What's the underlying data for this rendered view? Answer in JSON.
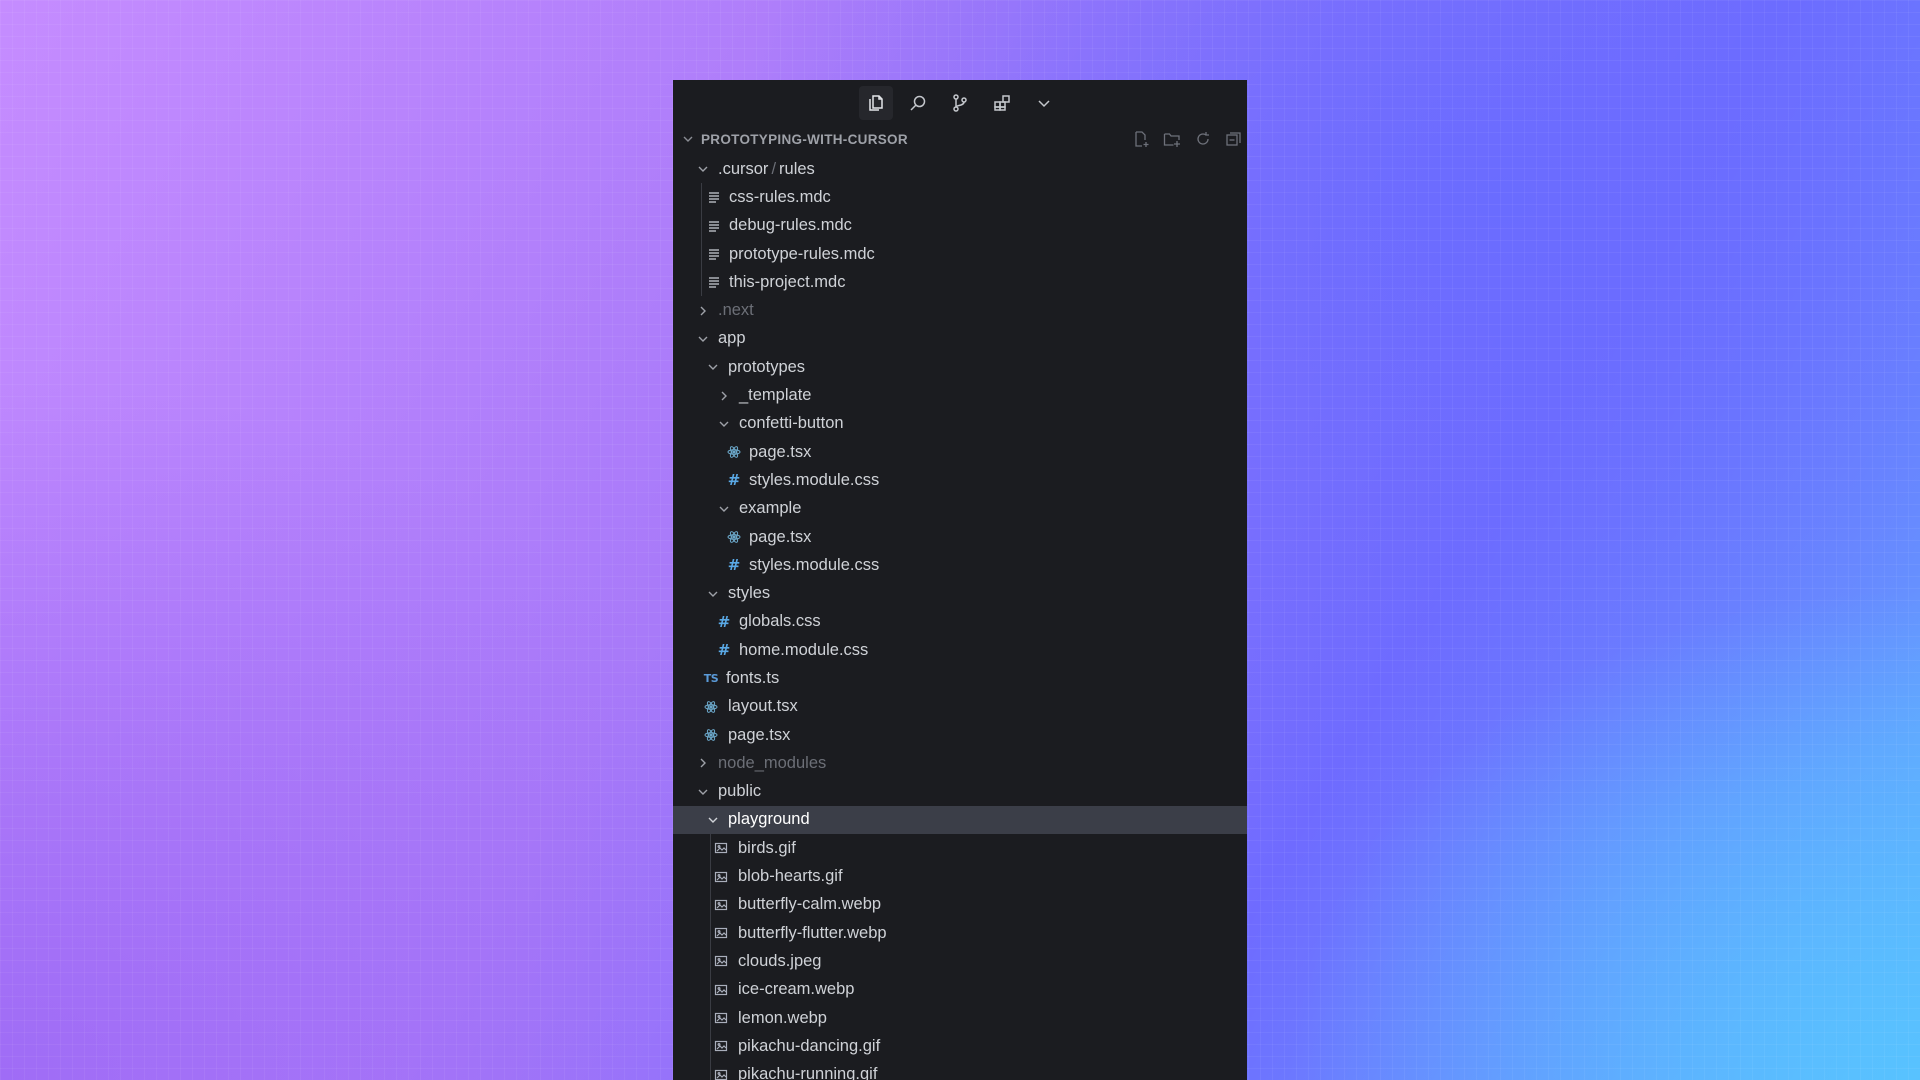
{
  "activity_bar": {
    "items": [
      {
        "icon": "files-icon",
        "active": true
      },
      {
        "icon": "search-icon",
        "active": false
      },
      {
        "icon": "source-control-icon",
        "active": false
      },
      {
        "icon": "extensions-icon",
        "active": false
      },
      {
        "icon": "chevron-down-icon",
        "active": false
      }
    ]
  },
  "explorer": {
    "title": "PROTOTYPING-WITH-CURSOR",
    "actions": [
      "new-file-icon",
      "new-folder-icon",
      "refresh-icon",
      "collapse-all-icon"
    ]
  },
  "tree": {
    "cursor_folder": {
      "part1": ".cursor",
      "sep": "/",
      "part2": "rules"
    },
    "css_rules": "css-rules.mdc",
    "debug_rules": "debug-rules.mdc",
    "prototype_rules": "prototype-rules.mdc",
    "this_project": "this-project.mdc",
    "next": ".next",
    "app": "app",
    "prototypes": "prototypes",
    "template": "_template",
    "confetti_button": "confetti-button",
    "confetti_page": "page.tsx",
    "confetti_styles": "styles.module.css",
    "example": "example",
    "example_page": "page.tsx",
    "example_styles": "styles.module.css",
    "styles": "styles",
    "globals": "globals.css",
    "home_module": "home.module.css",
    "fonts": "fonts.ts",
    "layout": "layout.tsx",
    "app_page": "page.tsx",
    "node_modules": "node_modules",
    "public": "public",
    "playground": "playground",
    "birds": "birds.gif",
    "blob_hearts": "blob-hearts.gif",
    "butterfly_calm": "butterfly-calm.webp",
    "butterfly_flutter": "butterfly-flutter.webp",
    "clouds": "clouds.jpeg",
    "ice_cream": "ice-cream.webp",
    "lemon": "lemon.webp",
    "pikachu_dancing": "pikachu-dancing.gif",
    "pikachu_running": "pikachu-running.gif"
  },
  "icon_glyphs": {
    "css": "#",
    "ts": "TS"
  },
  "colors": {
    "panel_bg": "#1b1c20",
    "selected_row": "#3b3e48",
    "css_icon": "#5aa9e6",
    "react_icon": "#6ba7c9"
  }
}
